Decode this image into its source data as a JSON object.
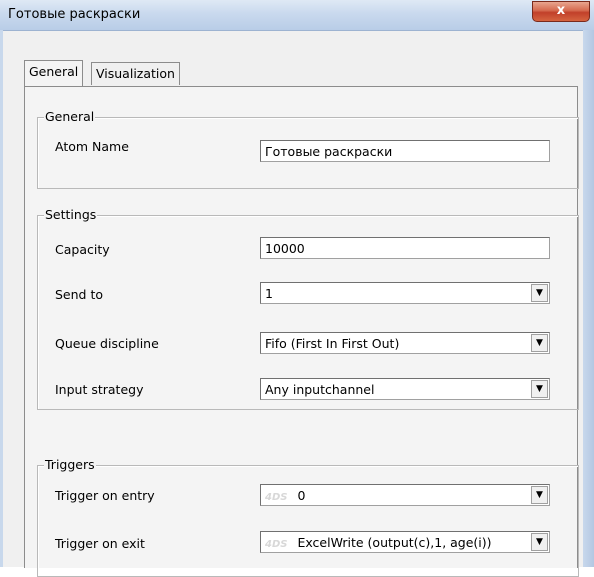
{
  "window": {
    "title": "Готовые раскраски",
    "close_label": "x"
  },
  "tabs": [
    {
      "label": "General",
      "active": true
    },
    {
      "label": "Visualization",
      "active": false
    }
  ],
  "general_group": {
    "legend": "General",
    "atom_name_label": "Atom Name",
    "atom_name_value": "Готовые раскраски"
  },
  "settings_group": {
    "legend": "Settings",
    "capacity_label": "Capacity",
    "capacity_value": "10000",
    "send_to_label": "Send to",
    "send_to_value": "1",
    "queue_label": "Queue discipline",
    "queue_value": "Fifo (First In First Out)",
    "input_label": "Input strategy",
    "input_value": "Any inputchannel"
  },
  "triggers_group": {
    "legend": "Triggers",
    "entry_label": "Trigger on entry",
    "entry_prefix": "4DS",
    "entry_value": "0",
    "exit_label": "Trigger on exit",
    "exit_prefix": "4DS",
    "exit_value": "ExcelWrite (output(c),1, age(i))"
  },
  "icons": {
    "dropdown": "chevron-down-icon",
    "close": "close-icon"
  }
}
